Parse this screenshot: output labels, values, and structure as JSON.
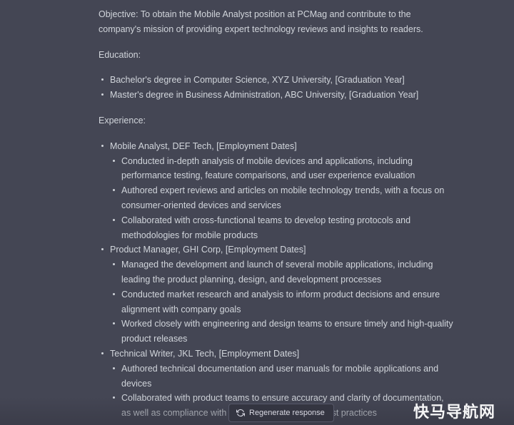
{
  "objective": "Objective: To obtain the Mobile Analyst position at PCMag and contribute to the company's mission of providing expert technology reviews and insights to readers.",
  "education": {
    "heading": "Education:",
    "items": [
      "Bachelor's degree in Computer Science, XYZ University, [Graduation Year]",
      "Master's degree in Business Administration, ABC University, [Graduation Year]"
    ]
  },
  "experience": {
    "heading": "Experience:",
    "jobs": [
      {
        "title": "Mobile Analyst, DEF Tech, [Employment Dates]",
        "bullets": [
          "Conducted in-depth analysis of mobile devices and applications, including performance testing, feature comparisons, and user experience evaluation",
          "Authored expert reviews and articles on mobile technology trends, with a focus on consumer-oriented devices and services",
          "Collaborated with cross-functional teams to develop testing protocols and methodologies for mobile products"
        ]
      },
      {
        "title": "Product Manager, GHI Corp, [Employment Dates]",
        "bullets": [
          "Managed the development and launch of several mobile applications, including leading the product planning, design, and development processes",
          "Conducted market research and analysis to inform product decisions and ensure alignment with company goals",
          "Worked closely with engineering and design teams to ensure timely and high-quality product releases"
        ]
      },
      {
        "title": "Technical Writer, JKL Tech, [Employment Dates]",
        "bullets": [
          "Authored technical documentation and user manuals for mobile applications and devices",
          "Collaborated with product teams to ensure accuracy and clarity of documentation, as well as compliance with industry standards and best practices"
        ]
      }
    ]
  },
  "regenerate_button": {
    "label": "Regenerate response",
    "icon": "refresh-icon"
  },
  "watermark": "快马导航网",
  "colors": {
    "background": "#444654",
    "text": "#d1d5db",
    "button_background": "#343541",
    "button_border": "#565869"
  }
}
